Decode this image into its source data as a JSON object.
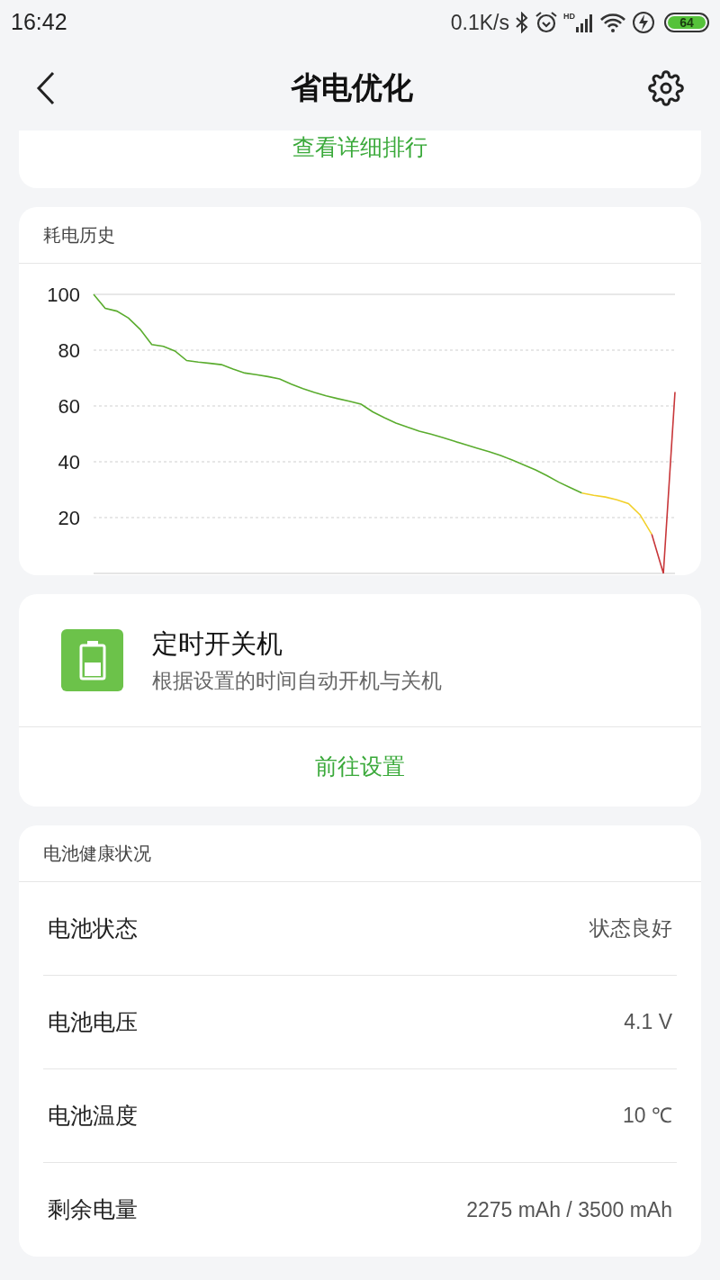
{
  "status_bar": {
    "time": "16:42",
    "speed": "0.1K/s",
    "network_label": "HD",
    "battery_percent": "64"
  },
  "header": {
    "title": "省电优化"
  },
  "ranking_card": {
    "link": "查看详细排行"
  },
  "history": {
    "title": "耗电历史",
    "chart_data": {
      "type": "line",
      "categories": [
        null,
        null,
        null,
        null,
        null,
        null,
        null,
        null,
        null,
        null,
        null,
        null,
        null,
        null,
        null,
        null,
        null,
        null,
        null,
        null,
        null,
        null,
        null,
        null,
        null,
        null,
        null,
        null,
        null,
        null,
        null,
        null,
        null,
        null,
        null,
        null,
        null,
        null,
        null,
        null,
        null,
        null,
        null,
        null,
        null,
        null,
        null,
        null,
        null,
        null,
        null
      ],
      "ylim": [
        0,
        100
      ],
      "grid": true,
      "yticks": [
        20,
        40,
        60,
        80,
        100
      ],
      "series": [
        {
          "color": "#5aac2e",
          "values": [
            100,
            95,
            94,
            91.5,
            87.5,
            82,
            81.4,
            79.7,
            76.3,
            75.7,
            75.3,
            74.8,
            73.2,
            71.8,
            71.2,
            70.5,
            69.7,
            67.8,
            66.2,
            64.8,
            63.6,
            62.6,
            61.7,
            60.6,
            57.9,
            55.8,
            53.9,
            52.4,
            51,
            49.9,
            48.7,
            47.4,
            46.1,
            44.8,
            43.6,
            42.3,
            40.6,
            38.9,
            37.1,
            35,
            32.7,
            30.7,
            28.8,
            null,
            null,
            null,
            null,
            null,
            null,
            null,
            null
          ]
        },
        {
          "color": "#f2d02a",
          "values": [
            null,
            null,
            null,
            null,
            null,
            null,
            null,
            null,
            null,
            null,
            null,
            null,
            null,
            null,
            null,
            null,
            null,
            null,
            null,
            null,
            null,
            null,
            null,
            null,
            null,
            null,
            null,
            null,
            null,
            null,
            null,
            null,
            null,
            null,
            null,
            null,
            null,
            null,
            null,
            null,
            null,
            null,
            28.8,
            28,
            27.4,
            26.4,
            25,
            21,
            14,
            null,
            null
          ]
        },
        {
          "color": "#c8373a",
          "values": [
            null,
            null,
            null,
            null,
            null,
            null,
            null,
            null,
            null,
            null,
            null,
            null,
            null,
            null,
            null,
            null,
            null,
            null,
            null,
            null,
            null,
            null,
            null,
            null,
            null,
            null,
            null,
            null,
            null,
            null,
            null,
            null,
            null,
            null,
            null,
            null,
            null,
            null,
            null,
            null,
            null,
            null,
            null,
            null,
            null,
            null,
            null,
            null,
            14,
            0,
            65
          ]
        }
      ]
    }
  },
  "schedule_card": {
    "title": "定时开关机",
    "description": "根据设置的时间自动开机与关机",
    "action": "前往设置"
  },
  "health": {
    "title": "电池健康状况",
    "rows": [
      {
        "label": "电池状态",
        "value": "状态良好"
      },
      {
        "label": "电池电压",
        "value": "4.1 V"
      },
      {
        "label": "电池温度",
        "value": "10 ℃"
      },
      {
        "label": "剩余电量",
        "value": "2275 mAh / 3500 mAh"
      }
    ]
  }
}
